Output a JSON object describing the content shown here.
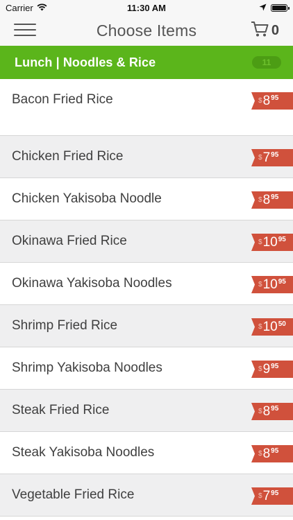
{
  "status_bar": {
    "carrier": "Carrier",
    "time": "11:30 AM"
  },
  "nav": {
    "title": "Choose Items",
    "cart_count": "0"
  },
  "category": {
    "title": "Lunch | Noodles & Rice",
    "count": "11"
  },
  "currency_symbol": "$",
  "items": [
    {
      "name": "Bacon Fried Rice",
      "dollars": "8",
      "cents": "95"
    },
    {
      "name": "Chicken Fried Rice",
      "dollars": "7",
      "cents": "95"
    },
    {
      "name": "Chicken Yakisoba Noodle",
      "dollars": "8",
      "cents": "95"
    },
    {
      "name": "Okinawa Fried Rice",
      "dollars": "10",
      "cents": "95"
    },
    {
      "name": "Okinawa Yakisoba Noodles",
      "dollars": "10",
      "cents": "95"
    },
    {
      "name": "Shrimp Fried Rice",
      "dollars": "10",
      "cents": "50"
    },
    {
      "name": "Shrimp Yakisoba Noodles",
      "dollars": "9",
      "cents": "95"
    },
    {
      "name": "Steak Fried Rice",
      "dollars": "8",
      "cents": "95"
    },
    {
      "name": "Steak Yakisoba Noodles",
      "dollars": "8",
      "cents": "95"
    },
    {
      "name": "Vegetable Fried Rice",
      "dollars": "7",
      "cents": "95"
    }
  ],
  "colors": {
    "accent_green": "#5bb51b",
    "price_red": "#d0513c"
  }
}
